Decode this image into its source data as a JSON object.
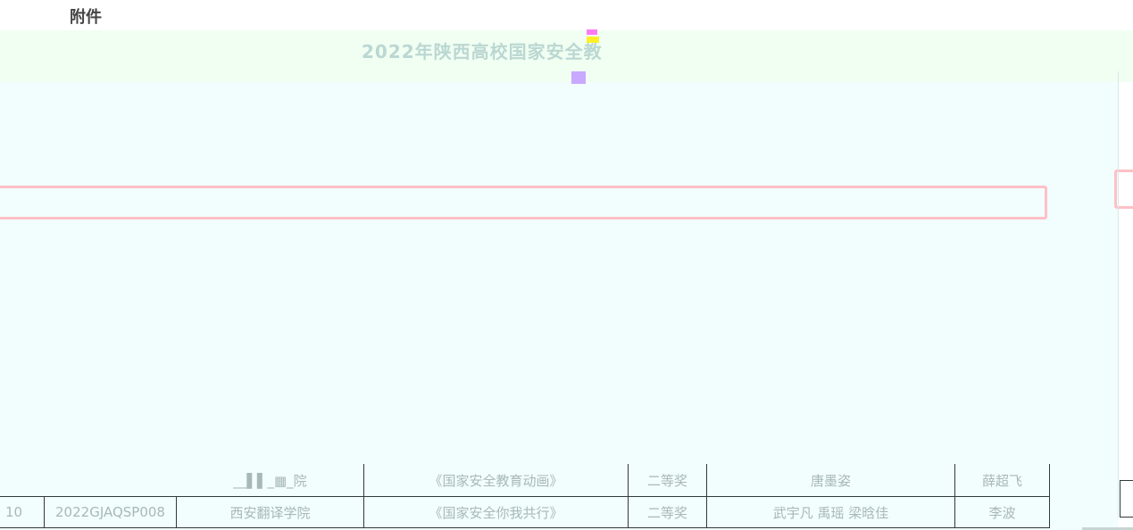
{
  "header": {
    "attachment_label": "附件",
    "title": "2022年陕西高校国家安全教"
  },
  "table": {
    "rows": [
      {
        "index": "",
        "code": "",
        "school": "__▌▌_▦_院",
        "work": "《国家安全教育动画》",
        "award": "二等奖",
        "authors": "唐墨姿",
        "advisor": "薛超飞"
      },
      {
        "index": "10",
        "code": "2022GJAQSP008",
        "school": "西安翻译学院",
        "work": "《国家安全你我共行》",
        "award": "二等奖",
        "authors": "武宇凡 禹瑶 梁晗佳",
        "advisor": "李波"
      }
    ]
  },
  "colors": {
    "document_background": "#f2fdfd",
    "highlight_border": "#ffc0c6",
    "table_border": "#2f3a3a"
  }
}
